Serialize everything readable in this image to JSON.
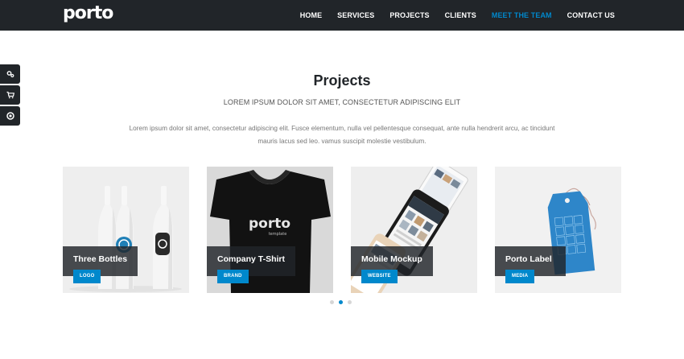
{
  "header": {
    "logo": "porto",
    "nav": [
      {
        "label": "HOME"
      },
      {
        "label": "SERVICES"
      },
      {
        "label": "PROJECTS"
      },
      {
        "label": "CLIENTS"
      },
      {
        "label": "MEET THE TEAM",
        "active": true
      },
      {
        "label": "CONTACT US"
      }
    ]
  },
  "sidetools": [
    "gears-icon",
    "cart-icon",
    "circle-dot-icon"
  ],
  "section": {
    "title": "Projects",
    "subtitle": "LOREM IPSUM DOLOR SIT AMET, CONSECTETUR ADIPISCING ELIT",
    "lead": "Lorem ipsum dolor sit amet, consectetur adipiscing elit. Fusce elementum, nulla vel pellentesque consequat, ante nulla hendrerit arcu, ac tincidunt mauris lacus sed leo. vamus suscipit molestie vestibulum."
  },
  "projects": [
    {
      "name": "Three Bottles",
      "tag": "LOGO"
    },
    {
      "name": "Company T-Shirt",
      "tag": "BRAND",
      "shirt_text": "porto",
      "shirt_subtext": "template"
    },
    {
      "name": "Mobile Mockup",
      "tag": "WEBSITE"
    },
    {
      "name": "Porto Label",
      "tag": "MEDIA"
    }
  ],
  "carousel": {
    "pages": 3,
    "active": 2
  },
  "colors": {
    "accent": "#0088cc",
    "header_bg": "#212529"
  }
}
